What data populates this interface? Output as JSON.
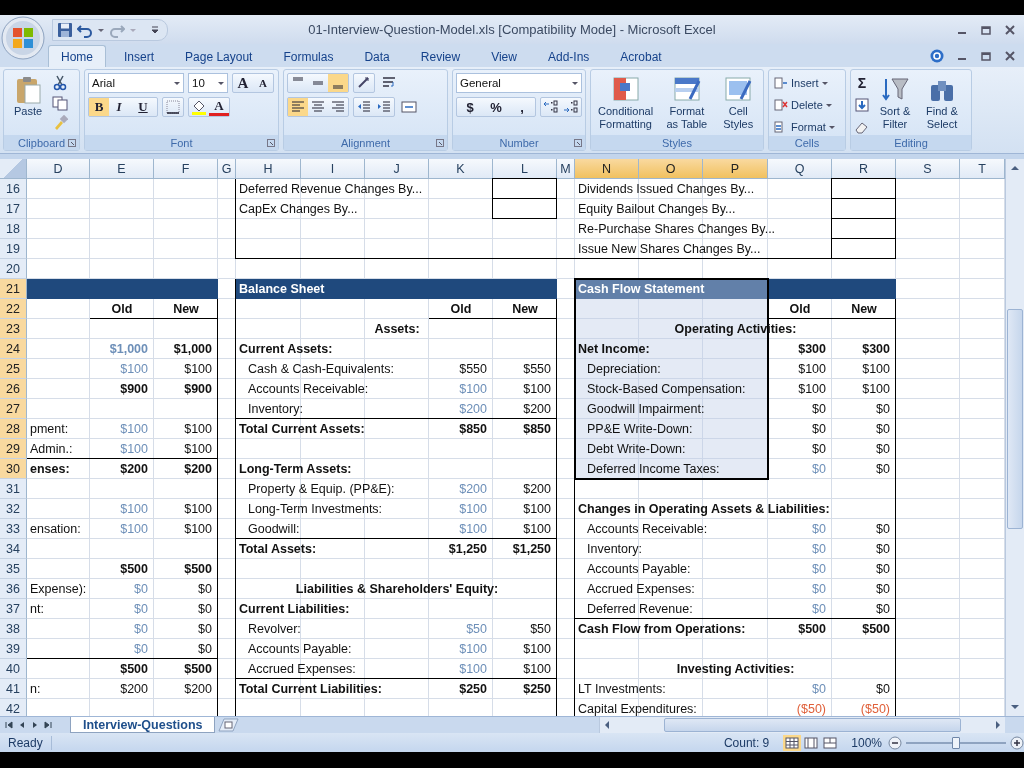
{
  "window": {
    "title": "01-Interview-Question-Model.xls  [Compatibility Mode] - Microsoft Excel"
  },
  "tabs": [
    {
      "label": "Home",
      "selected": true
    },
    {
      "label": "Insert",
      "selected": false
    },
    {
      "label": "Page Layout",
      "selected": false
    },
    {
      "label": "Formulas",
      "selected": false
    },
    {
      "label": "Data",
      "selected": false
    },
    {
      "label": "Review",
      "selected": false
    },
    {
      "label": "View",
      "selected": false
    },
    {
      "label": "Add-Ins",
      "selected": false
    },
    {
      "label": "Acrobat",
      "selected": false
    }
  ],
  "ribbon": {
    "groups": [
      {
        "label": "Clipboard",
        "launcher": true
      },
      {
        "label": "Font",
        "launcher": true
      },
      {
        "label": "Alignment",
        "launcher": true
      },
      {
        "label": "Number",
        "launcher": true
      },
      {
        "label": "Styles",
        "launcher": false
      },
      {
        "label": "Cells",
        "launcher": false
      },
      {
        "label": "Editing",
        "launcher": false
      }
    ],
    "paste": "Paste",
    "font_name": "Arial",
    "font_size": "10",
    "grow_font": "A",
    "shrink_font": "A",
    "text_style_buttons": [
      {
        "label": "B",
        "selected": true
      },
      {
        "label": "I",
        "selected": false
      },
      {
        "label": "U",
        "selected": false
      }
    ],
    "font_color": "A",
    "vertical_align": [
      {
        "selected": false
      },
      {
        "selected": false
      },
      {
        "selected": true
      }
    ],
    "horizontal_align": [
      {
        "selected": true
      },
      {
        "selected": false
      },
      {
        "selected": false
      }
    ],
    "number_format": "General",
    "currency": "$",
    "percent": "%",
    "comma": ",",
    "styles_buttons": [
      {
        "label": "Conditional Formatting"
      },
      {
        "label": "Format as Table"
      },
      {
        "label": "Cell Styles"
      }
    ],
    "cells_buttons": [
      {
        "label": "Insert"
      },
      {
        "label": "Delete"
      },
      {
        "label": "Format"
      }
    ],
    "autosum": "Σ",
    "editing_buttons": [
      {
        "label": "Sort & Filter"
      },
      {
        "label": "Find & Select"
      }
    ]
  },
  "sheet": {
    "columns": [
      {
        "label": "D",
        "selected": false
      },
      {
        "label": "E",
        "selected": false
      },
      {
        "label": "F",
        "selected": false
      },
      {
        "label": "G",
        "selected": false
      },
      {
        "label": "H",
        "selected": false
      },
      {
        "label": "I",
        "selected": false
      },
      {
        "label": "J",
        "selected": false
      },
      {
        "label": "K",
        "selected": false
      },
      {
        "label": "L",
        "selected": false
      },
      {
        "label": "M",
        "selected": false
      },
      {
        "label": "N",
        "selected": true
      },
      {
        "label": "O",
        "selected": true
      },
      {
        "label": "P",
        "selected": true
      },
      {
        "label": "Q",
        "selected": false
      },
      {
        "label": "R",
        "selected": false
      },
      {
        "label": "S",
        "selected": false
      },
      {
        "label": "T",
        "selected": false
      }
    ],
    "rows": [
      {
        "label": "16",
        "selected": false,
        "cells": [
          "",
          "",
          "",
          "",
          {
            "kind": "label",
            "text": "Deferred Revenue Changes By..."
          },
          "",
          "",
          "",
          {
            "boxed": true
          },
          "",
          {
            "kind": "label",
            "text": "Dividends Issued Changes By..."
          },
          "",
          "",
          "",
          {
            "boxed": true
          }
        ]
      },
      {
        "label": "17",
        "selected": false,
        "cells": [
          "",
          "",
          "",
          "",
          {
            "kind": "label",
            "text": "CapEx Changes By..."
          },
          "",
          "",
          "",
          {
            "boxed": true
          },
          "",
          {
            "kind": "label",
            "text": "Equity Bailout Changes By..."
          },
          "",
          "",
          "",
          {
            "boxed": true
          }
        ]
      },
      {
        "label": "18",
        "selected": false,
        "cells": [
          "",
          "",
          "",
          "",
          "",
          "",
          "",
          "",
          "",
          "",
          {
            "kind": "label",
            "text": "Re-Purchase Shares Changes By..."
          },
          "",
          "",
          "",
          {
            "boxed": true
          }
        ]
      },
      {
        "label": "19",
        "selected": false,
        "cells": [
          "",
          "",
          "",
          "",
          "",
          "",
          "",
          "",
          "",
          "",
          {
            "kind": "label",
            "text": "Issue New Shares Changes By..."
          },
          "",
          "",
          "",
          {
            "boxed": true
          }
        ]
      },
      {
        "label": "20",
        "selected": false,
        "cells": [
          "",
          "",
          "",
          "",
          {
            "rule": true
          },
          {
            "rule": true
          },
          {
            "rule": true
          },
          {
            "rule": true
          },
          {
            "rule": true
          },
          {
            "rule": true
          },
          {
            "rule": true
          },
          {
            "rule": true
          },
          {
            "rule": true
          },
          {
            "rule": true
          }
        ]
      },
      {
        "label": "21",
        "selected": true,
        "header_band": true,
        "cells": [
          "",
          "",
          "",
          "",
          {
            "kind": "title",
            "text": "Balance Sheet"
          },
          "",
          "",
          "",
          "",
          "",
          {
            "kind": "title",
            "text": "Cash Flow Statement"
          }
        ]
      },
      {
        "label": "22",
        "selected": true,
        "cells": [
          "",
          {
            "kind": "center",
            "bold": true,
            "text": "Old"
          },
          {
            "kind": "center",
            "bold": true,
            "text": "New"
          },
          "",
          "",
          "",
          "",
          {
            "kind": "center",
            "bold": true,
            "text": "Old"
          },
          {
            "kind": "center",
            "bold": true,
            "text": "New"
          },
          "",
          "",
          "",
          "",
          {
            "kind": "center",
            "bold": true,
            "text": "Old"
          },
          {
            "kind": "center",
            "bold": true,
            "text": "New"
          }
        ]
      },
      {
        "label": "23",
        "selected": true,
        "cells": [
          "",
          {
            "rule": true
          },
          {
            "rule": true
          },
          "",
          "",
          "",
          {
            "kind": "center",
            "bold": true,
            "text": "Assets:"
          },
          {
            "rule": true
          },
          {
            "rule": true
          },
          "",
          "",
          "",
          {
            "kind": "center",
            "bold": true,
            "text": "Operating Activities:"
          },
          {
            "rule": true
          },
          {
            "rule": true
          }
        ]
      },
      {
        "label": "24",
        "selected": true,
        "cells": [
          "",
          {
            "kind": "number",
            "bold": true,
            "input": true,
            "text": "$1,000"
          },
          {
            "kind": "number",
            "bold": true,
            "text": "$1,000"
          },
          "",
          {
            "kind": "label",
            "bold": true,
            "text": "Current Assets:"
          },
          "",
          "",
          "",
          "",
          "",
          {
            "kind": "label",
            "bold": true,
            "text": "Net Income:"
          },
          "",
          "",
          {
            "kind": "number",
            "bold": true,
            "text": "$300"
          },
          {
            "kind": "number",
            "bold": true,
            "text": "$300"
          }
        ]
      },
      {
        "label": "25",
        "selected": true,
        "cells": [
          "",
          {
            "kind": "number",
            "input": true,
            "text": "$100"
          },
          {
            "kind": "number",
            "text": "$100"
          },
          "",
          {
            "kind": "label",
            "indent": true,
            "text": "Cash & Cash-Equivalents:"
          },
          "",
          "",
          {
            "kind": "number",
            "text": "$550"
          },
          {
            "kind": "number",
            "text": "$550"
          },
          "",
          {
            "kind": "label",
            "indent": true,
            "text": "Depreciation:"
          },
          "",
          "",
          {
            "kind": "number",
            "text": "$100"
          },
          {
            "kind": "number",
            "text": "$100"
          }
        ]
      },
      {
        "label": "26",
        "selected": true,
        "cells": [
          "",
          {
            "kind": "number",
            "bold": true,
            "text": "$900"
          },
          {
            "kind": "number",
            "bold": true,
            "text": "$900"
          },
          "",
          {
            "kind": "label",
            "indent": true,
            "text": "Accounts Receivable:"
          },
          "",
          "",
          {
            "kind": "number",
            "input": true,
            "text": "$100"
          },
          {
            "kind": "number",
            "text": "$100"
          },
          "",
          {
            "kind": "label",
            "indent": true,
            "text": "Stock-Based Compensation:"
          },
          "",
          "",
          {
            "kind": "number",
            "text": "$100"
          },
          {
            "kind": "number",
            "text": "$100"
          }
        ]
      },
      {
        "label": "27",
        "selected": true,
        "cells": [
          "",
          "",
          "",
          "",
          {
            "kind": "label",
            "indent": true,
            "text": "Inventory:"
          },
          "",
          "",
          {
            "kind": "number",
            "input": true,
            "text": "$200"
          },
          {
            "kind": "number",
            "text": "$200"
          },
          "",
          {
            "kind": "label",
            "indent": true,
            "text": "Goodwill Impairment:"
          },
          "",
          "",
          {
            "kind": "number",
            "text": "$0"
          },
          {
            "kind": "number",
            "text": "$0"
          }
        ]
      },
      {
        "label": "28",
        "selected": true,
        "cells": [
          {
            "kind": "label",
            "text": "pment:"
          },
          {
            "kind": "number",
            "input": true,
            "text": "$100"
          },
          {
            "kind": "number",
            "text": "$100"
          },
          "",
          {
            "kind": "label",
            "bold": true,
            "rule": true,
            "text": "Total Current Assets:"
          },
          {
            "rule": true
          },
          {
            "rule": true
          },
          {
            "kind": "number",
            "bold": true,
            "rule": true,
            "text": "$850"
          },
          {
            "kind": "number",
            "bold": true,
            "rule": true,
            "text": "$850"
          },
          "",
          {
            "kind": "label",
            "indent": true,
            "text": "PP&E Write-Down:"
          },
          "",
          "",
          {
            "kind": "number",
            "text": "$0"
          },
          {
            "kind": "number",
            "text": "$0"
          }
        ]
      },
      {
        "label": "29",
        "selected": true,
        "cells": [
          {
            "kind": "label",
            "text": "Admin.:"
          },
          {
            "kind": "number",
            "input": true,
            "text": "$100"
          },
          {
            "kind": "number",
            "text": "$100"
          },
          "",
          "",
          "",
          "",
          "",
          "",
          "",
          {
            "kind": "label",
            "indent": true,
            "text": "Debt Write-Down:"
          },
          "",
          "",
          {
            "kind": "number",
            "text": "$0"
          },
          {
            "kind": "number",
            "text": "$0"
          }
        ]
      },
      {
        "label": "30",
        "selected": true,
        "cells": [
          {
            "kind": "label",
            "bold": true,
            "rule": true,
            "text": "enses:"
          },
          {
            "kind": "number",
            "bold": true,
            "rule": true,
            "text": "$200"
          },
          {
            "kind": "number",
            "bold": true,
            "rule": true,
            "text": "$200"
          },
          "",
          {
            "kind": "label",
            "bold": true,
            "text": "Long-Term Assets:"
          },
          "",
          "",
          "",
          "",
          "",
          {
            "kind": "label",
            "indent": true,
            "text": "Deferred Income Taxes:"
          },
          "",
          "",
          {
            "kind": "number",
            "input": true,
            "text": "$0"
          },
          {
            "kind": "number",
            "text": "$0"
          }
        ]
      },
      {
        "label": "31",
        "selected": false,
        "cells": [
          "",
          "",
          "",
          "",
          {
            "kind": "label",
            "indent": true,
            "text": "Property & Equip. (PP&E):"
          },
          "",
          "",
          {
            "kind": "number",
            "input": true,
            "text": "$200"
          },
          {
            "kind": "number",
            "text": "$200"
          }
        ]
      },
      {
        "label": "32",
        "selected": false,
        "cells": [
          "",
          {
            "kind": "number",
            "input": true,
            "text": "$100"
          },
          {
            "kind": "number",
            "text": "$100"
          },
          "",
          {
            "kind": "label",
            "indent": true,
            "text": "Long-Term Investments:"
          },
          "",
          "",
          {
            "kind": "number",
            "input": true,
            "text": "$100"
          },
          {
            "kind": "number",
            "text": "$100"
          },
          "",
          {
            "kind": "label",
            "bold": true,
            "text": "Changes in Operating Assets & Liabilities:"
          }
        ]
      },
      {
        "label": "33",
        "selected": false,
        "cells": [
          {
            "kind": "label",
            "text": "ensation:"
          },
          {
            "kind": "number",
            "input": true,
            "text": "$100"
          },
          {
            "kind": "number",
            "text": "$100"
          },
          "",
          {
            "kind": "label",
            "indent": true,
            "text": "Goodwill:"
          },
          "",
          "",
          {
            "kind": "number",
            "input": true,
            "text": "$100"
          },
          {
            "kind": "number",
            "text": "$100"
          },
          "",
          {
            "kind": "label",
            "indent": true,
            "text": "Accounts Receivable:"
          },
          "",
          "",
          {
            "kind": "number",
            "input": true,
            "text": "$0"
          },
          {
            "kind": "number",
            "text": "$0"
          }
        ]
      },
      {
        "label": "34",
        "selected": false,
        "cells": [
          "",
          "",
          "",
          "",
          {
            "kind": "label",
            "bold": true,
            "rule": true,
            "text": "Total Assets:"
          },
          {
            "rule": true
          },
          {
            "rule": true
          },
          {
            "kind": "number",
            "bold": true,
            "rule": true,
            "text": "$1,250"
          },
          {
            "kind": "number",
            "bold": true,
            "rule": true,
            "text": "$1,250"
          },
          "",
          {
            "kind": "label",
            "indent": true,
            "text": "Inventory:"
          },
          "",
          "",
          {
            "kind": "number",
            "input": true,
            "text": "$0"
          },
          {
            "kind": "number",
            "text": "$0"
          }
        ]
      },
      {
        "label": "35",
        "selected": false,
        "cells": [
          "",
          {
            "kind": "number",
            "bold": true,
            "text": "$500"
          },
          {
            "kind": "number",
            "bold": true,
            "text": "$500"
          },
          "",
          "",
          "",
          "",
          "",
          "",
          "",
          {
            "kind": "label",
            "indent": true,
            "text": "Accounts Payable:"
          },
          "",
          "",
          {
            "kind": "number",
            "input": true,
            "text": "$0"
          },
          {
            "kind": "number",
            "text": "$0"
          }
        ]
      },
      {
        "label": "36",
        "selected": false,
        "cells": [
          {
            "kind": "label",
            "text": "Expense):"
          },
          {
            "kind": "number",
            "input": true,
            "text": "$0"
          },
          {
            "kind": "number",
            "text": "$0"
          },
          "",
          "",
          "",
          {
            "kind": "center",
            "bold": true,
            "text": "Liabilities & Shareholders' Equity:"
          },
          "",
          "",
          "",
          {
            "kind": "label",
            "indent": true,
            "text": "Accrued Expenses:"
          },
          "",
          "",
          {
            "kind": "number",
            "input": true,
            "text": "$0"
          },
          {
            "kind": "number",
            "text": "$0"
          }
        ]
      },
      {
        "label": "37",
        "selected": false,
        "cells": [
          {
            "kind": "label",
            "text": "nt:"
          },
          {
            "kind": "number",
            "input": true,
            "text": "$0"
          },
          {
            "kind": "number",
            "text": "$0"
          },
          "",
          {
            "kind": "label",
            "bold": true,
            "text": "Current Liabilities:"
          },
          "",
          "",
          "",
          "",
          "",
          {
            "kind": "label",
            "indent": true,
            "text": "Deferred Revenue:"
          },
          "",
          "",
          {
            "kind": "number",
            "input": true,
            "text": "$0"
          },
          {
            "kind": "number",
            "text": "$0"
          }
        ]
      },
      {
        "label": "38",
        "selected": false,
        "cells": [
          "",
          {
            "kind": "number",
            "input": true,
            "text": "$0"
          },
          {
            "kind": "number",
            "text": "$0"
          },
          "",
          {
            "kind": "label",
            "indent": true,
            "text": "Revolver:"
          },
          "",
          "",
          {
            "kind": "number",
            "input": true,
            "text": "$50"
          },
          {
            "kind": "number",
            "text": "$50"
          },
          "",
          {
            "kind": "label",
            "bold": true,
            "rule": true,
            "text": "Cash Flow from Operations:"
          },
          {
            "rule": true
          },
          {
            "rule": true
          },
          {
            "kind": "number",
            "bold": true,
            "rule": true,
            "text": "$500"
          },
          {
            "kind": "number",
            "bold": true,
            "rule": true,
            "text": "$500"
          }
        ]
      },
      {
        "label": "39",
        "selected": false,
        "cells": [
          "",
          {
            "kind": "number",
            "input": true,
            "text": "$0"
          },
          {
            "kind": "number",
            "text": "$0"
          },
          "",
          {
            "kind": "label",
            "indent": true,
            "text": "Accounts Payable:"
          },
          "",
          "",
          {
            "kind": "number",
            "input": true,
            "text": "$100"
          },
          {
            "kind": "number",
            "text": "$100"
          }
        ]
      },
      {
        "label": "40",
        "selected": false,
        "cells": [
          {
            "rule": true
          },
          {
            "kind": "number",
            "bold": true,
            "rule": true,
            "text": "$500"
          },
          {
            "kind": "number",
            "bold": true,
            "rule": true,
            "text": "$500"
          },
          "",
          {
            "kind": "label",
            "indent": true,
            "text": "Accrued Expenses:"
          },
          "",
          "",
          {
            "kind": "number",
            "input": true,
            "text": "$100"
          },
          {
            "kind": "number",
            "text": "$100"
          },
          "",
          "",
          "",
          {
            "kind": "center",
            "bold": true,
            "text": "Investing Activities:"
          }
        ]
      },
      {
        "label": "41",
        "selected": false,
        "cells": [
          {
            "kind": "label",
            "text": "n:"
          },
          {
            "kind": "number",
            "text": "$200"
          },
          {
            "kind": "number",
            "text": "$200"
          },
          "",
          {
            "kind": "label",
            "bold": true,
            "rule": true,
            "text": "Total Current Liabilities:"
          },
          {
            "rule": true
          },
          {
            "rule": true
          },
          {
            "kind": "number",
            "bold": true,
            "rule": true,
            "text": "$250"
          },
          {
            "kind": "number",
            "bold": true,
            "rule": true,
            "text": "$250"
          },
          "",
          {
            "kind": "label",
            "text": "LT Investments:"
          },
          "",
          "",
          {
            "kind": "number",
            "input": true,
            "text": "$0"
          },
          {
            "kind": "number",
            "text": "$0"
          }
        ]
      },
      {
        "label": "42",
        "selected": false,
        "cells": [
          "",
          "",
          "",
          "",
          "",
          "",
          "",
          "",
          "",
          "",
          {
            "kind": "label",
            "text": "Capital Expenditures:"
          },
          "",
          "",
          {
            "kind": "number",
            "negative": true,
            "text": "($50)"
          },
          {
            "kind": "number",
            "negative": true,
            "text": "($50)"
          }
        ]
      }
    ]
  },
  "sheet_tabs": [
    {
      "label": "Interview-Questions",
      "selected": true
    }
  ],
  "status_bar": {
    "text": "Ready",
    "count": "Count: 9",
    "views": [
      {
        "selected": true
      },
      {
        "selected": false
      },
      {
        "selected": false
      }
    ],
    "zoom": "100%",
    "zoom_slider": {
      "level": 0.5
    }
  }
}
